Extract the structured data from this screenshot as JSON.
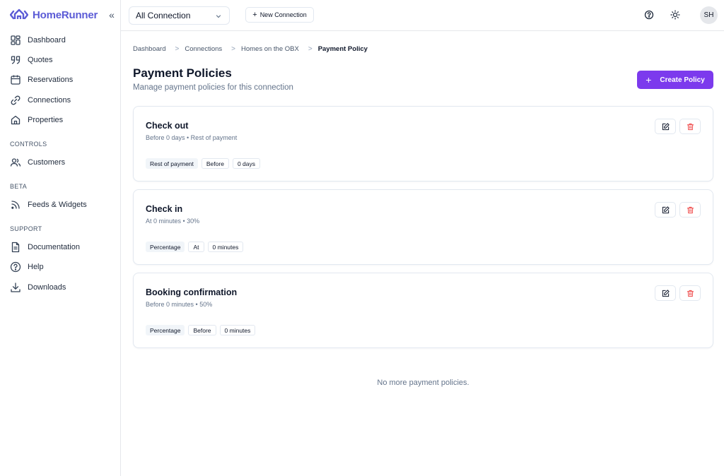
{
  "app": {
    "brand_name": "HomeRunner",
    "collapse_label": "«",
    "accent_color": "#7c3aed",
    "brand_color": "#5b5bd6"
  },
  "sidebar": {
    "main_items": [
      {
        "label": "Dashboard",
        "icon": "dashboard-grid-icon"
      },
      {
        "label": "Quotes",
        "icon": "quote-icon"
      },
      {
        "label": "Reservations",
        "icon": "calendar-icon"
      },
      {
        "label": "Connections",
        "icon": "link-icon"
      },
      {
        "label": "Properties",
        "icon": "home-icon"
      }
    ],
    "sections": [
      {
        "title": "CONTROLS",
        "items": [
          {
            "label": "Customers",
            "icon": "users-icon"
          }
        ]
      },
      {
        "title": "BETA",
        "items": [
          {
            "label": "Feeds & Widgets",
            "icon": "rss-icon"
          }
        ]
      },
      {
        "title": "SUPPORT",
        "items": [
          {
            "label": "Documentation",
            "icon": "document-icon"
          },
          {
            "label": "Help",
            "icon": "help-circle-icon"
          },
          {
            "label": "Downloads",
            "icon": "download-icon"
          }
        ]
      }
    ]
  },
  "topbar": {
    "connection_select_value": "All Connection",
    "new_connection_label": "New Connection",
    "new_connection_plus": "+",
    "avatar_initials": "SH"
  },
  "breadcrumb": [
    "Dashboard",
    "Connections",
    "Homes on the OBX",
    "Payment Policy"
  ],
  "breadcrumb_separator": ">",
  "page": {
    "title": "Payment Policies",
    "subtitle": "Manage payment policies for this connection",
    "create_button_label": "Create Policy",
    "create_button_plus": "+",
    "empty_note": "No more payment policies."
  },
  "policies": [
    {
      "title": "Check out",
      "description": "Before 0 days • Rest of payment",
      "tags": [
        "Rest of payment",
        "Before",
        "0 days"
      ]
    },
    {
      "title": "Check in",
      "description": "At 0 minutes • 30%",
      "tags": [
        "Percentage",
        "At",
        "0 minutes"
      ]
    },
    {
      "title": "Booking confirmation",
      "description": "Before 0 minutes • 50%",
      "tags": [
        "Percentage",
        "Before",
        "0 minutes"
      ]
    }
  ]
}
